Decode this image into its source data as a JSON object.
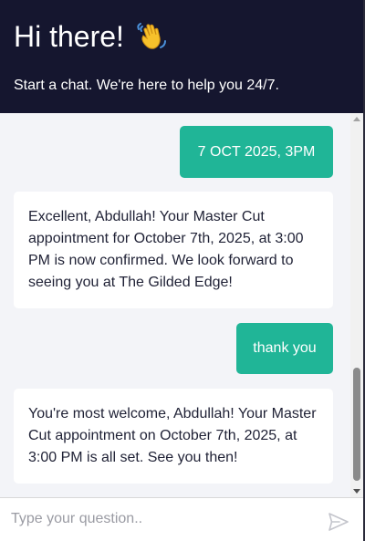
{
  "header": {
    "title": "Hi there!",
    "wave_emoji": "👋",
    "subtitle": "Start a chat. We're here to help you 24/7."
  },
  "messages": [
    {
      "role": "user",
      "text": "7 OCT 2025, 3PM"
    },
    {
      "role": "bot",
      "text": "Excellent, Abdullah! Your Master Cut appointment for October 7th, 2025, at 3:00 PM is now confirmed. We look forward to seeing you at The Gilded Edge!"
    },
    {
      "role": "user",
      "text": "thank you"
    },
    {
      "role": "bot",
      "text": "You're most welcome, Abdullah! Your Master Cut appointment on October 7th, 2025, at 3:00 PM is all set. See you then!"
    }
  ],
  "input": {
    "placeholder": "Type your question..",
    "value": ""
  },
  "icons": {
    "wave": "waving-hand-icon",
    "send": "send-icon"
  },
  "colors": {
    "header_bg": "#15162f",
    "accent": "#20b597",
    "chat_bg": "#f3f4f8"
  }
}
